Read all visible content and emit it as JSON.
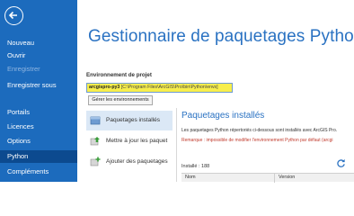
{
  "sidebar": {
    "items": [
      {
        "label": "Nouveau",
        "state": "normal"
      },
      {
        "label": "Ouvrir",
        "state": "normal"
      },
      {
        "label": "Enregistrer",
        "state": "disabled"
      },
      {
        "label": "Enregistrer sous",
        "state": "normal"
      },
      {
        "label": "Portails",
        "state": "normal"
      },
      {
        "label": "Licences",
        "state": "normal"
      },
      {
        "label": "Options",
        "state": "normal"
      },
      {
        "label": "Python",
        "state": "active"
      },
      {
        "label": "Compléments",
        "state": "normal"
      }
    ]
  },
  "main": {
    "title": "Gestionnaire de paquetages Python",
    "env_section_label": "Environnement de projet",
    "env_name": "arcgispro-py3",
    "env_path": "[C:\\Program Files\\ArcGIS\\Pro\\bin\\Python\\envs]",
    "manage_button": "Gérer les environnements"
  },
  "tabs": [
    {
      "label": "Paquetages installés",
      "icon": "package-icon",
      "active": true
    },
    {
      "label": "Mettre à jour les paquet",
      "icon": "update-arrow-icon",
      "active": false
    },
    {
      "label": "Ajouter des paquetages",
      "icon": "add-package-icon",
      "active": false
    }
  ],
  "panel": {
    "title": "Paquetages installés",
    "description": "Les paquetages Python répertoriés ci-dessous sont installés avec ArcGIS Pro.",
    "note": "Remarque : impossible de modifier l'environnement Python par défaut (arcgi",
    "installed_count": "Installé : 188",
    "columns": {
      "name": "Nom",
      "version": "Version"
    }
  },
  "colors": {
    "sidebar_bg": "#1c6bbd",
    "sidebar_active": "#0c4a8f",
    "accent": "#2a72c2",
    "env_highlight": "#f7ee4c",
    "note_red": "#c0392b"
  }
}
